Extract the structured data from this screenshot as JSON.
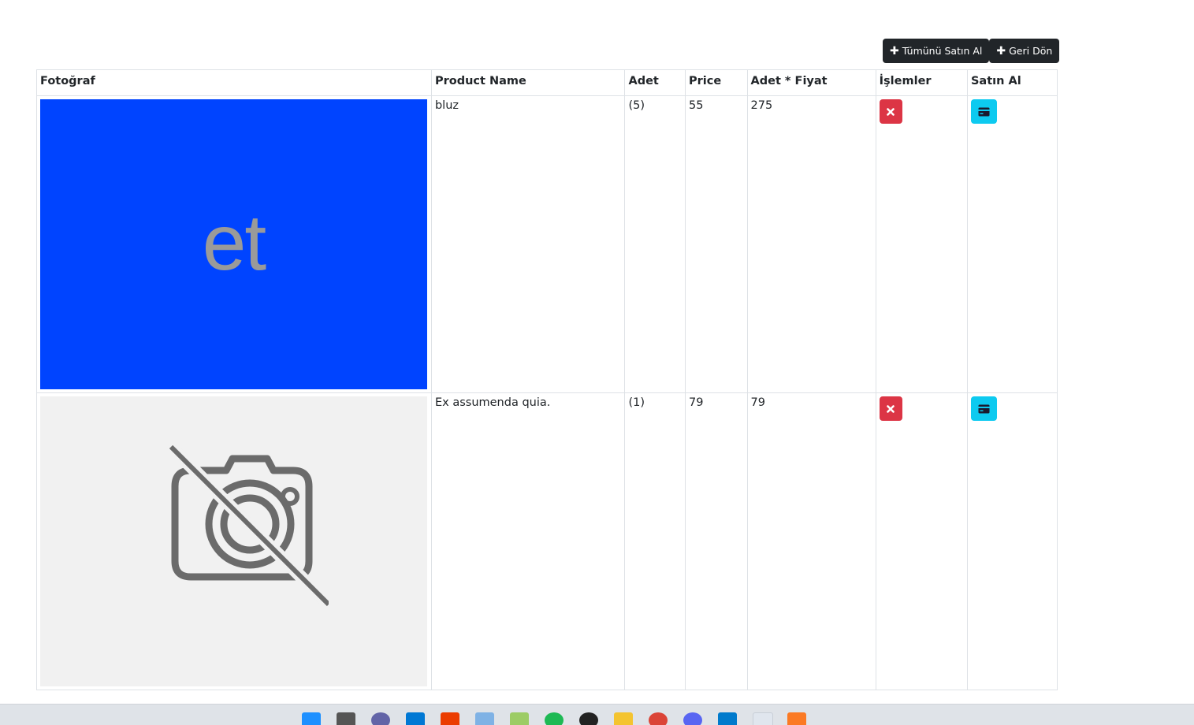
{
  "toolbar": {
    "buy_all_label": "Tümünü Satın Al",
    "go_back_label": "Geri Dön"
  },
  "table": {
    "headers": {
      "photo": "Fotoğraf",
      "name": "Product Name",
      "quantity": "Adet",
      "price": "Price",
      "total": "Adet * Fiyat",
      "operations": "İşlemler",
      "buy": "Satın Al"
    },
    "rows": [
      {
        "photo_text": "et",
        "name": "bluz",
        "quantity": "(5)",
        "price": "55",
        "total": "275"
      },
      {
        "photo_text": "No photo",
        "name": "Ex assumenda quia.",
        "quantity": "(1)",
        "price": "79",
        "total": "79"
      }
    ]
  },
  "colors": {
    "dark_button": "#212529",
    "danger": "#dc3545",
    "info": "#0dcaf0",
    "product_image_bg": "#0044ff"
  },
  "taskbar": {
    "icons": [
      "windows-start-icon",
      "task-view-icon",
      "teams-icon",
      "store-icon",
      "office-icon",
      "mail-icon",
      "notepad-icon",
      "spotify-icon",
      "recorder-icon",
      "file-explorer-icon",
      "chrome-icon",
      "discord-icon",
      "vscode-icon",
      "snipping-tool-icon",
      "xampp-icon"
    ]
  }
}
